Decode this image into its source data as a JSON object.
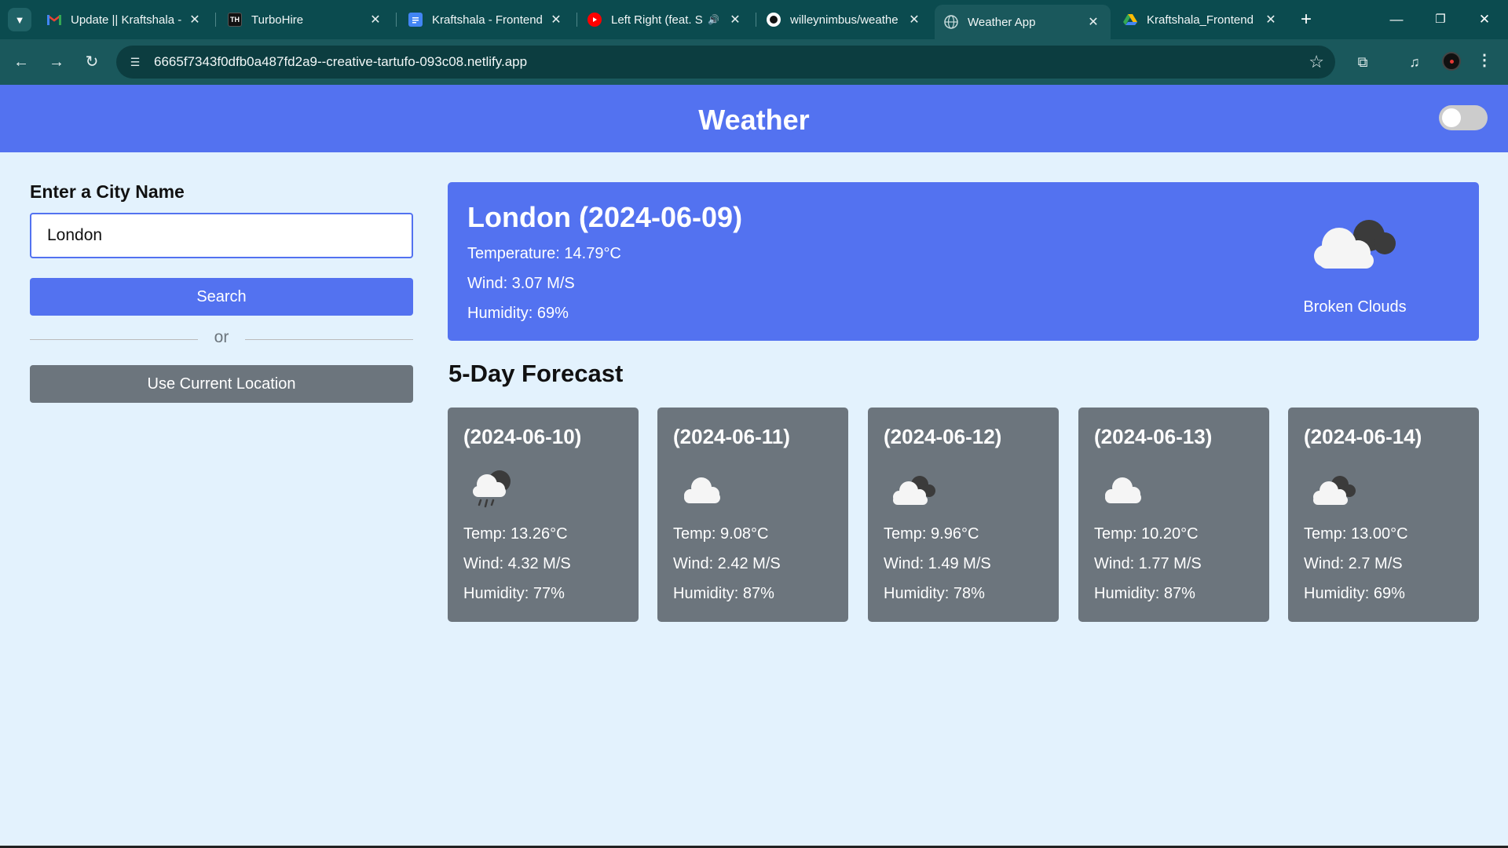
{
  "browser": {
    "tabs": [
      {
        "label": "Update || Kraftshala -",
        "icon": "gmail-icon"
      },
      {
        "label": "TurboHire",
        "icon": "turbohire-icon",
        "icon_text": "TH"
      },
      {
        "label": "Kraftshala - Frontend",
        "icon": "docs-icon"
      },
      {
        "label": "Left Right (feat. S",
        "icon": "youtube-music-icon"
      },
      {
        "label": "willeynimbus/weathe",
        "icon": "github-icon"
      },
      {
        "label": "Weather App",
        "icon": "globe-icon",
        "active": true
      },
      {
        "label": "Kraftshala_Frontend",
        "icon": "drive-icon"
      }
    ],
    "url": "6665f7343f0dfb0a487fd2a9--creative-tartufo-093c08.netlify.app"
  },
  "header": {
    "title": "Weather"
  },
  "search": {
    "label": "Enter a City Name",
    "value": "London",
    "button_label": "Search",
    "divider_text": "or",
    "location_button_label": "Use Current Location"
  },
  "current": {
    "title": "London (2024-06-09)",
    "temperature": "Temperature: 14.79°C",
    "wind": "Wind: 3.07 M/S",
    "humidity": "Humidity: 69%",
    "description": "Broken Clouds",
    "icon": "broken-clouds-icon"
  },
  "forecast": {
    "title": "5-Day Forecast",
    "days": [
      {
        "date": "(2024-06-10)",
        "temp": "Temp: 13.26°C",
        "wind": "Wind: 4.32 M/S",
        "humidity": "Humidity: 77%",
        "icon": "rain-icon"
      },
      {
        "date": "(2024-06-11)",
        "temp": "Temp: 9.08°C",
        "wind": "Wind: 2.42 M/S",
        "humidity": "Humidity: 87%",
        "icon": "cloud-icon"
      },
      {
        "date": "(2024-06-12)",
        "temp": "Temp: 9.96°C",
        "wind": "Wind: 1.49 M/S",
        "humidity": "Humidity: 78%",
        "icon": "broken-clouds-icon"
      },
      {
        "date": "(2024-06-13)",
        "temp": "Temp: 10.20°C",
        "wind": "Wind: 1.77 M/S",
        "humidity": "Humidity: 87%",
        "icon": "cloud-icon"
      },
      {
        "date": "(2024-06-14)",
        "temp": "Temp: 13.00°C",
        "wind": "Wind: 2.7 M/S",
        "humidity": "Humidity: 69%",
        "icon": "broken-clouds-icon"
      }
    ]
  },
  "colors": {
    "accent": "#5372f0",
    "card": "#6c757d",
    "background": "#e3f2fd"
  }
}
